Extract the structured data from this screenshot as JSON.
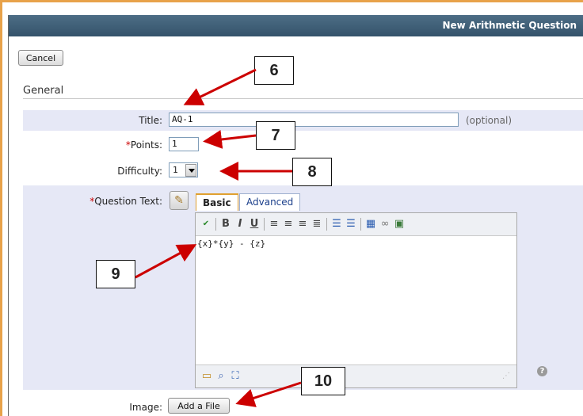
{
  "window": {
    "title": "New Arithmetic Question"
  },
  "toolbar": {
    "cancel_label": "Cancel"
  },
  "section": {
    "general": "General"
  },
  "form": {
    "title_label": "Title:",
    "title_value": "AQ-1",
    "title_hint": "(optional)",
    "points_label": "Points:",
    "points_value": "1",
    "difficulty_label": "Difficulty:",
    "difficulty_value": "1",
    "question_text_label": "Question Text:",
    "question_text_value": "{x}*{y} - {z}",
    "image_label": "Image:",
    "add_file_label": "Add a File"
  },
  "editor": {
    "tabs": [
      "Basic",
      "Advanced"
    ],
    "active_tab": "Basic",
    "toolbar_icons": [
      "spellcheck-icon",
      "bold-icon",
      "italic-icon",
      "underline-icon",
      "align-left-icon",
      "align-center-icon",
      "align-right-icon",
      "justify-icon",
      "bulleted-list-icon",
      "numbered-list-icon",
      "table-icon",
      "link-icon",
      "image-icon"
    ],
    "footer_icons": [
      "preview-icon",
      "find-icon",
      "fullscreen-icon"
    ]
  },
  "callouts": [
    "6",
    "7",
    "8",
    "9",
    "10"
  ],
  "colors": {
    "titlebar": "#3f5f78",
    "band": "#e6e8f6",
    "arrow": "#cc0000",
    "frame": "#e8a24a"
  }
}
